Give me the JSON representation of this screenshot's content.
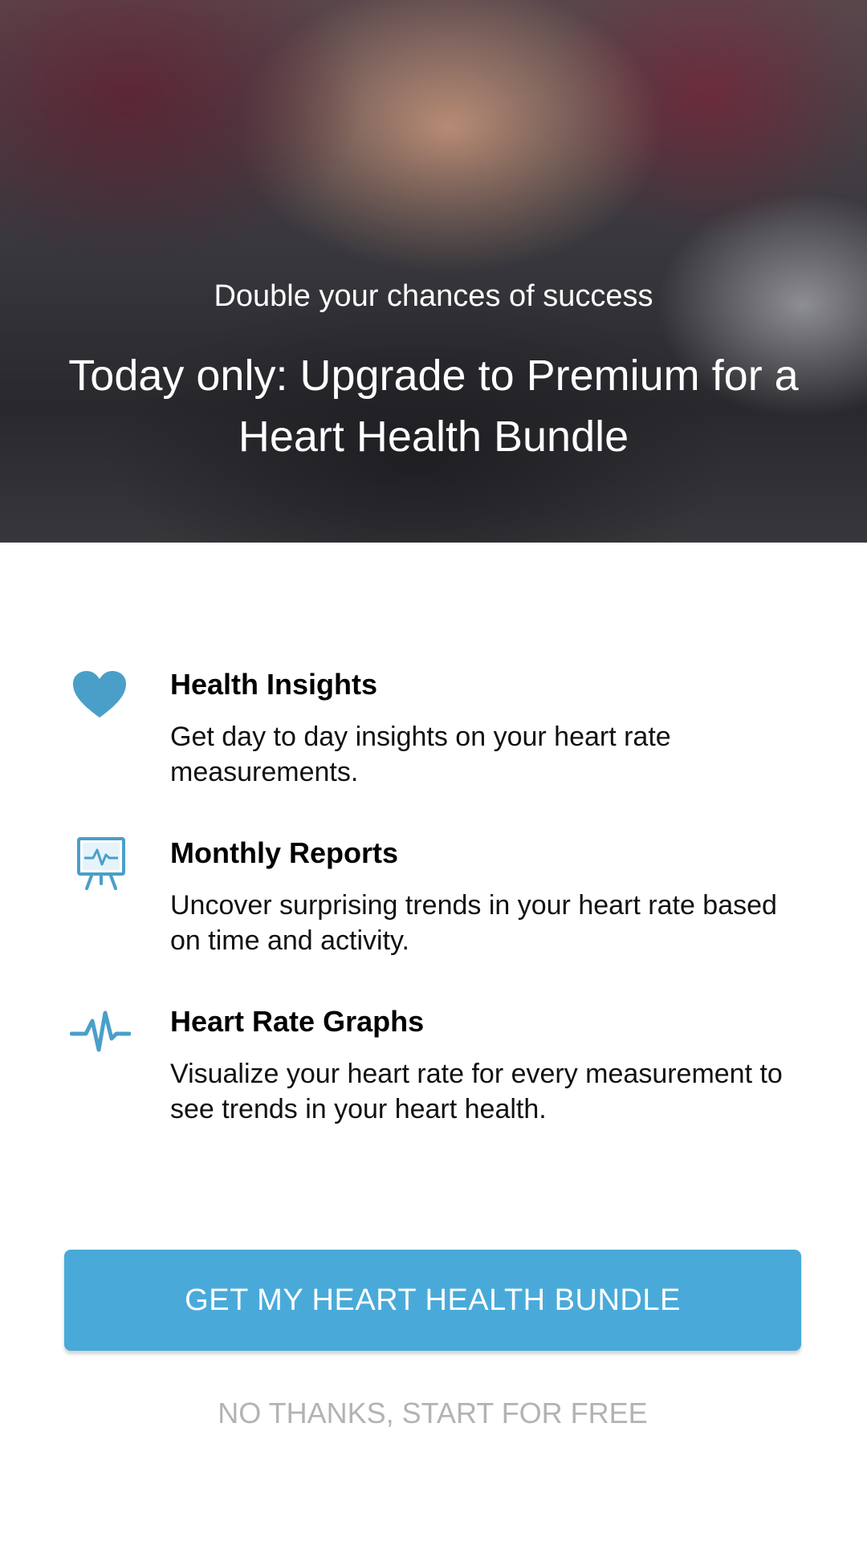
{
  "hero": {
    "kicker": "Double your chances of success",
    "title": "Today only: Upgrade to Premium for a Heart Health Bundle"
  },
  "features": [
    {
      "icon": "heart-icon",
      "title": "Health Insights",
      "description": "Get day to day insights on your heart rate measurements."
    },
    {
      "icon": "report-board-icon",
      "title": "Monthly Reports",
      "description": "Uncover surprising trends in your heart rate based on time and activity."
    },
    {
      "icon": "heartbeat-line-icon",
      "title": "Heart Rate Graphs",
      "description": "Visualize your heart rate for every measurement to see trends in your heart health."
    }
  ],
  "actions": {
    "primary_label": "GET MY HEART HEALTH BUNDLE",
    "secondary_label": "NO THANKS, START FOR FREE"
  },
  "colors": {
    "accent": "#49aad9",
    "icon": "#4a9fc9",
    "muted_text": "#b3b3b3"
  }
}
